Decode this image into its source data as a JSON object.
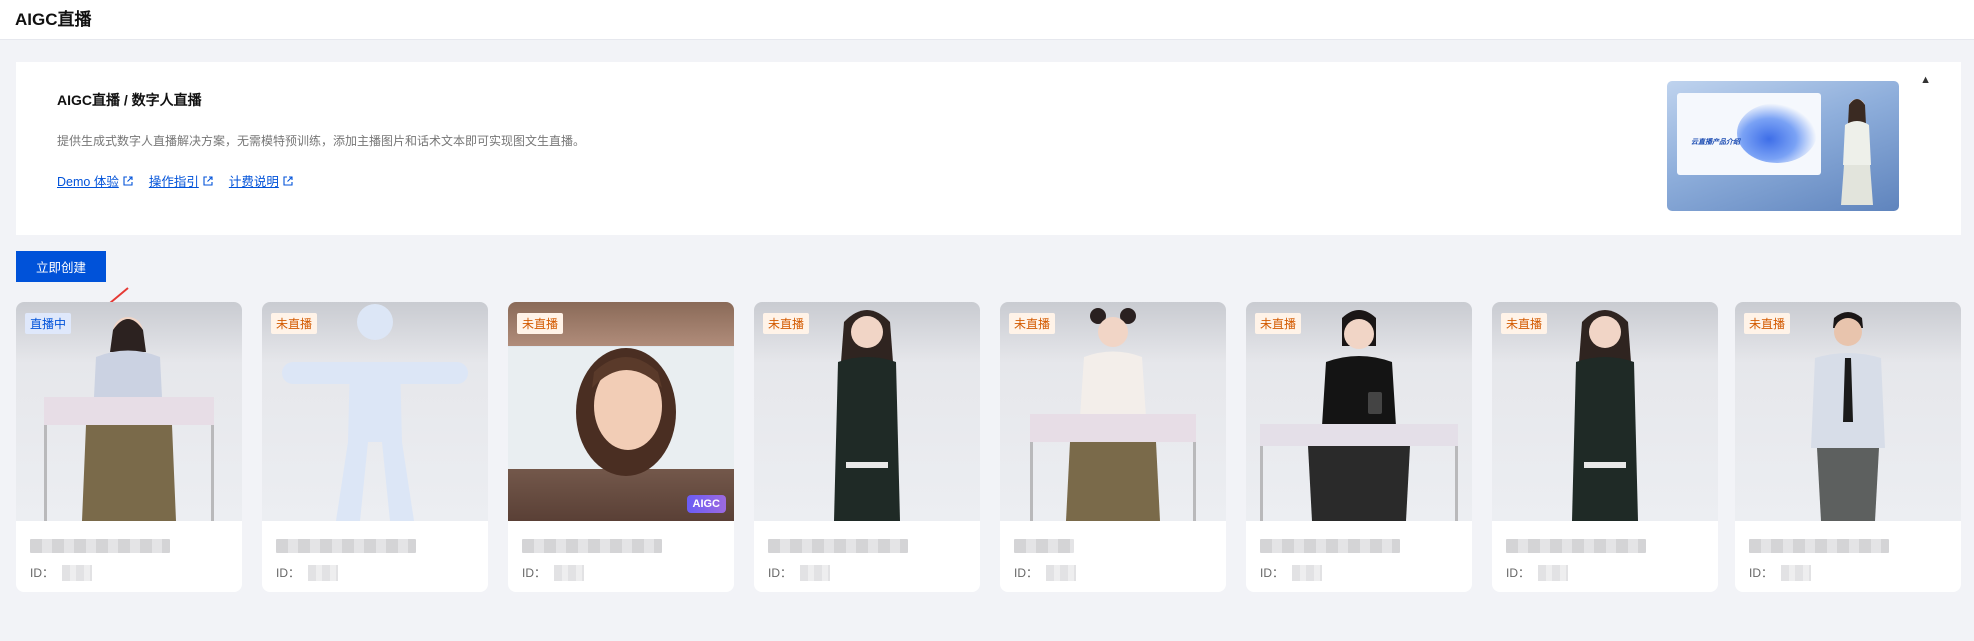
{
  "page": {
    "title": "AIGC直播"
  },
  "intro": {
    "title": "AIGC直播 / 数字人直播",
    "description": "提供生成式数字人直播解决方案，无需模特预训练，添加主播图片和话术文本即可实现图文生直播。",
    "links": [
      {
        "label": "Demo 体验"
      },
      {
        "label": "操作指引"
      },
      {
        "label": "计费说明"
      }
    ],
    "thumbnail": {
      "slide_title": "云直播产品介绍"
    },
    "collapse_icon": "triangle-up-icon"
  },
  "actions": {
    "create_label": "立即创建"
  },
  "cards": [
    {
      "status": "直播中",
      "status_type": "live",
      "id_label": "ID：",
      "avatar": "woman-seated-at-desk"
    },
    {
      "status": "未直播",
      "status_type": "off",
      "id_label": "ID：",
      "avatar": "placeholder-silhouette"
    },
    {
      "status": "未直播",
      "status_type": "off",
      "id_label": "ID：",
      "avatar": "portrait-photo",
      "tag": "AIGC"
    },
    {
      "status": "未直播",
      "status_type": "off",
      "id_label": "ID：",
      "avatar": "woman-standing"
    },
    {
      "status": "未直播",
      "status_type": "off",
      "id_label": "ID：",
      "avatar": "woman-seated-at-desk"
    },
    {
      "status": "未直播",
      "status_type": "off",
      "id_label": "ID：",
      "avatar": "woman-at-podium"
    },
    {
      "status": "未直播",
      "status_type": "off",
      "id_label": "ID：",
      "avatar": "woman-standing"
    },
    {
      "status": "未直播",
      "status_type": "off",
      "id_label": "ID：",
      "avatar": "man-standing"
    }
  ],
  "colors": {
    "primary": "#0052d9",
    "live_badge_bg": "#dfe8fb",
    "off_badge_bg": "#fff3e8",
    "off_badge_text": "#d35a00",
    "page_bg": "#f2f3f7"
  }
}
